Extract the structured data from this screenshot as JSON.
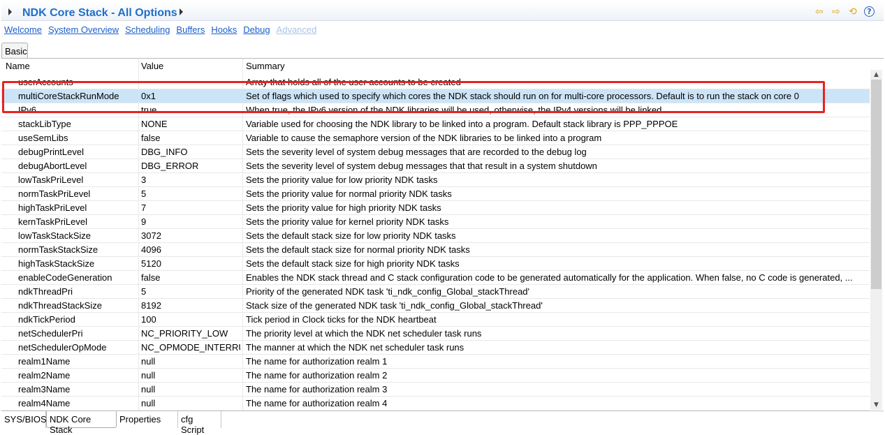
{
  "header": {
    "title": "NDK Core Stack - All Options",
    "icons": [
      "back-arrow-icon",
      "forward-arrow-icon",
      "refresh-icon",
      "help-icon"
    ]
  },
  "nav_links": [
    {
      "label": "Welcome",
      "enabled": true
    },
    {
      "label": "System Overview",
      "enabled": true
    },
    {
      "label": "Scheduling",
      "enabled": true
    },
    {
      "label": "Buffers",
      "enabled": true
    },
    {
      "label": "Hooks",
      "enabled": true
    },
    {
      "label": "Debug",
      "enabled": true
    },
    {
      "label": "Advanced",
      "enabled": false
    }
  ],
  "tab": "Basic",
  "table": {
    "columns": [
      "Name",
      "Value",
      "Summary"
    ],
    "rows": [
      [
        "userAccounts",
        "",
        "Array that holds all of the user accounts to be created"
      ],
      [
        "multiCoreStackRunMode",
        "0x1",
        "Set of flags which used to specify which cores the NDK stack should run  on for multi-core processors.  Default is to run the stack on core 0"
      ],
      [
        "IPv6",
        "true",
        "When true, the IPv6 version of the NDK libraries will be used, otherwise, the IPv4 versions will be linked"
      ],
      [
        "stackLibType",
        "NONE",
        "Variable used for choosing the NDK library to be linked into a program.  Default stack library is PPP_PPPOE"
      ],
      [
        "useSemLibs",
        "false",
        "Variable to cause the semaphore version of the NDK libraries to be linked into a program"
      ],
      [
        "debugPrintLevel",
        "DBG_INFO",
        "Sets the severity level of system debug messages that are recorded to  the debug log"
      ],
      [
        "debugAbortLevel",
        "DBG_ERROR",
        "Sets the severity level of system debug messages that that result in a  system shutdown"
      ],
      [
        "lowTaskPriLevel",
        "3",
        "Sets the priority value for low priority NDK tasks"
      ],
      [
        "normTaskPriLevel",
        "5",
        "Sets the priority value for normal priority NDK tasks"
      ],
      [
        "highTaskPriLevel",
        "7",
        "Sets the priority value for high priority NDK tasks"
      ],
      [
        "kernTaskPriLevel",
        "9",
        "Sets the priority value for kernel priority NDK tasks"
      ],
      [
        "lowTaskStackSize",
        "3072",
        "Sets the default stack size for low priority NDK tasks"
      ],
      [
        "normTaskStackSize",
        "4096",
        "Sets the default stack size for normal priority NDK tasks"
      ],
      [
        "highTaskStackSize",
        "5120",
        "Sets the default stack size for high priority NDK tasks"
      ],
      [
        "enableCodeGeneration",
        "false",
        "Enables the NDK stack thread and C stack configuration code to be  generated automatically for the application. When false, no C code is  generated, ..."
      ],
      [
        "ndkThreadPri",
        "5",
        "Priority of the generated NDK task 'ti_ndk_config_Global_stackThread'"
      ],
      [
        "ndkThreadStackSize",
        "8192",
        "Stack size of the generated NDK task 'ti_ndk_config_Global_stackThread'"
      ],
      [
        "ndkTickPeriod",
        "100",
        "Tick period in Clock ticks for the NDK heartbeat"
      ],
      [
        "netSchedulerPri",
        "NC_PRIORITY_LOW",
        "The priority level at which the NDK net scheduler task runs"
      ],
      [
        "netSchedulerOpMode",
        "NC_OPMODE_INTERRUPT",
        "The manner at which the NDK net scheduler task runs"
      ],
      [
        "realm1Name",
        "null",
        "The name for authorization realm 1"
      ],
      [
        "realm2Name",
        "null",
        "The name for authorization realm 2"
      ],
      [
        "realm3Name",
        "null",
        "The name for authorization realm 3"
      ],
      [
        "realm4Name",
        "null",
        "The name for authorization realm 4"
      ]
    ],
    "selected_row": 1
  },
  "bottom_tabs": [
    {
      "label": "SYS/BIOS"
    },
    {
      "label": "NDK Core Stack",
      "active": true
    },
    {
      "label": "Properties"
    },
    {
      "label": "cfg Script"
    }
  ],
  "colors": {
    "title": "#1e6fc8",
    "link": "#1a5fcc",
    "selection": "#cce4f7",
    "highlight_box": "#e8231e"
  }
}
